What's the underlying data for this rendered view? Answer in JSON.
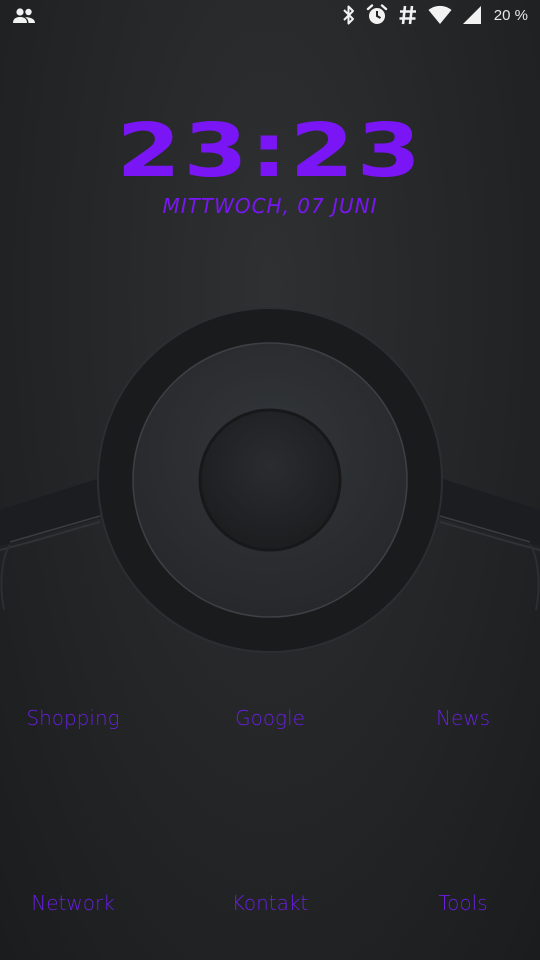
{
  "status_bar": {
    "icons": [
      "contacts-icon",
      "bluetooth-icon",
      "alarm-icon",
      "hashtag-icon",
      "wifi-icon",
      "signal-icon"
    ],
    "battery": "20 %"
  },
  "clock": {
    "time": "23:23",
    "date": "MITTWOCH, 07 JUNI"
  },
  "colors": {
    "accent": "#7a16f5",
    "label": "#6a1fe0",
    "background": "#232527"
  },
  "shortcuts": {
    "row1": [
      "Shopping",
      "Google",
      "News"
    ],
    "row2": [
      "Network",
      "Kontakt",
      "Tools"
    ]
  }
}
